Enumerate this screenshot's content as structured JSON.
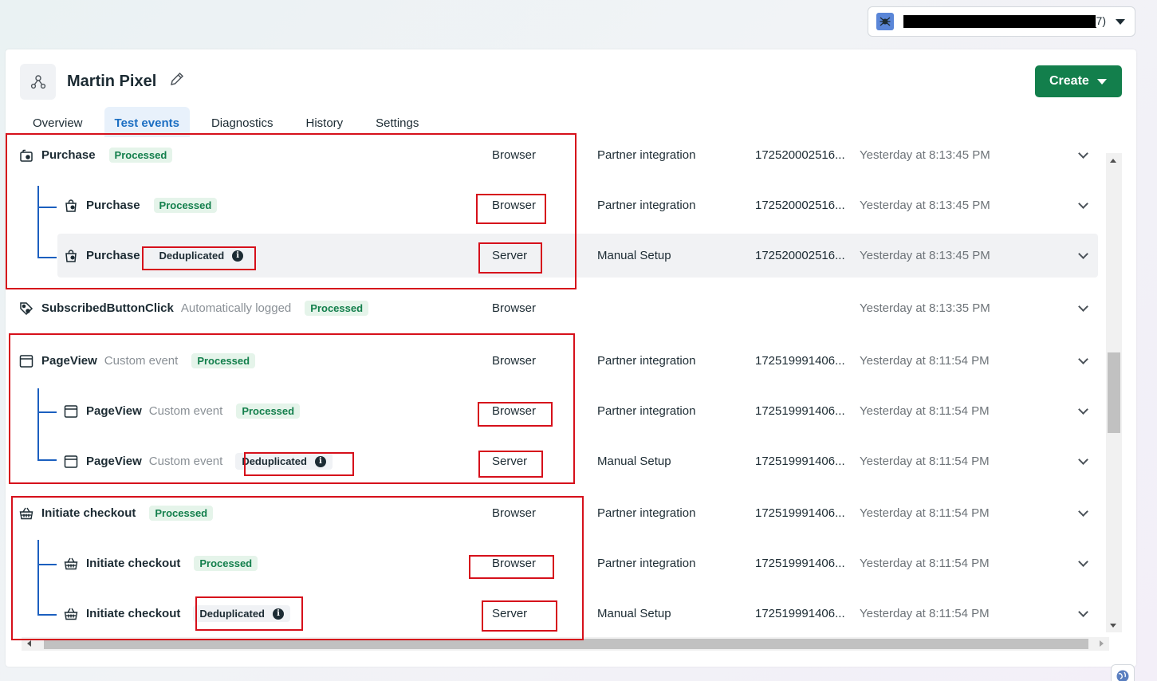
{
  "account": {
    "name_suffix": "7)",
    "avatar_icon": "bug-icon"
  },
  "header": {
    "pixel_name": "Martin Pixel",
    "create_label": "Create"
  },
  "tabs": [
    {
      "label": "Overview",
      "active": false
    },
    {
      "label": "Test events",
      "active": true
    },
    {
      "label": "Diagnostics",
      "active": false
    },
    {
      "label": "History",
      "active": false
    },
    {
      "label": "Settings",
      "active": false
    }
  ],
  "events": [
    {
      "name": "Purchase",
      "sub": "",
      "badge": "Processed",
      "badge_type": "processed",
      "source": "Browser",
      "method": "Partner integration",
      "id": "172520002516...",
      "time": "Yesterday at 8:13:45 PM",
      "icon": "cart-icon",
      "level": 0
    },
    {
      "name": "Purchase",
      "sub": "",
      "badge": "Processed",
      "badge_type": "processed",
      "source": "Browser",
      "method": "Partner integration",
      "id": "172520002516...",
      "time": "Yesterday at 8:13:45 PM",
      "icon": "bag-icon",
      "level": 1
    },
    {
      "name": "Purchase",
      "sub": "",
      "badge": "Deduplicated",
      "badge_type": "deduplicated",
      "source": "Server",
      "method": "Manual Setup",
      "id": "172520002516...",
      "time": "Yesterday at 8:13:45 PM",
      "icon": "bag-icon",
      "level": 1
    },
    {
      "name": "SubscribedButtonClick",
      "sub": "Automatically logged",
      "badge": "Processed",
      "badge_type": "processed",
      "source": "Browser",
      "method": "",
      "id": "",
      "time": "Yesterday at 8:13:35 PM",
      "icon": "tag-icon",
      "level": 0
    },
    {
      "name": "PageView",
      "sub": "Custom event",
      "badge": "Processed",
      "badge_type": "processed",
      "source": "Browser",
      "method": "Partner integration",
      "id": "172519991406...",
      "time": "Yesterday at 8:11:54 PM",
      "icon": "page-icon",
      "level": 0
    },
    {
      "name": "PageView",
      "sub": "Custom event",
      "badge": "Processed",
      "badge_type": "processed",
      "source": "Browser",
      "method": "Partner integration",
      "id": "172519991406...",
      "time": "Yesterday at 8:11:54 PM",
      "icon": "page-icon",
      "level": 1
    },
    {
      "name": "PageView",
      "sub": "Custom event",
      "badge": "Deduplicated",
      "badge_type": "deduplicated",
      "source": "Server",
      "method": "Manual Setup",
      "id": "172519991406...",
      "time": "Yesterday at 8:11:54 PM",
      "icon": "page-icon",
      "level": 1
    },
    {
      "name": "Initiate checkout",
      "sub": "",
      "badge": "Processed",
      "badge_type": "processed",
      "source": "Browser",
      "method": "Partner integration",
      "id": "172519991406...",
      "time": "Yesterday at 8:11:54 PM",
      "icon": "basket-icon",
      "level": 0
    },
    {
      "name": "Initiate checkout",
      "sub": "",
      "badge": "Processed",
      "badge_type": "processed",
      "source": "Browser",
      "method": "Partner integration",
      "id": "172519991406...",
      "time": "Yesterday at 8:11:54 PM",
      "icon": "basket-icon",
      "level": 1
    },
    {
      "name": "Initiate checkout",
      "sub": "",
      "badge": "Deduplicated",
      "badge_type": "deduplicated",
      "source": "Server",
      "method": "Manual Setup",
      "id": "172519991406...",
      "time": "Yesterday at 8:11:54 PM",
      "icon": "basket-icon",
      "level": 1
    }
  ],
  "colors": {
    "accent": "#1b6ec2",
    "create_button": "#137f4c",
    "processed_badge_bg": "#e5f4ea",
    "processed_badge_text": "#137f4c",
    "annotation_red": "#d6101b",
    "tree_line": "#1b5fbf"
  }
}
